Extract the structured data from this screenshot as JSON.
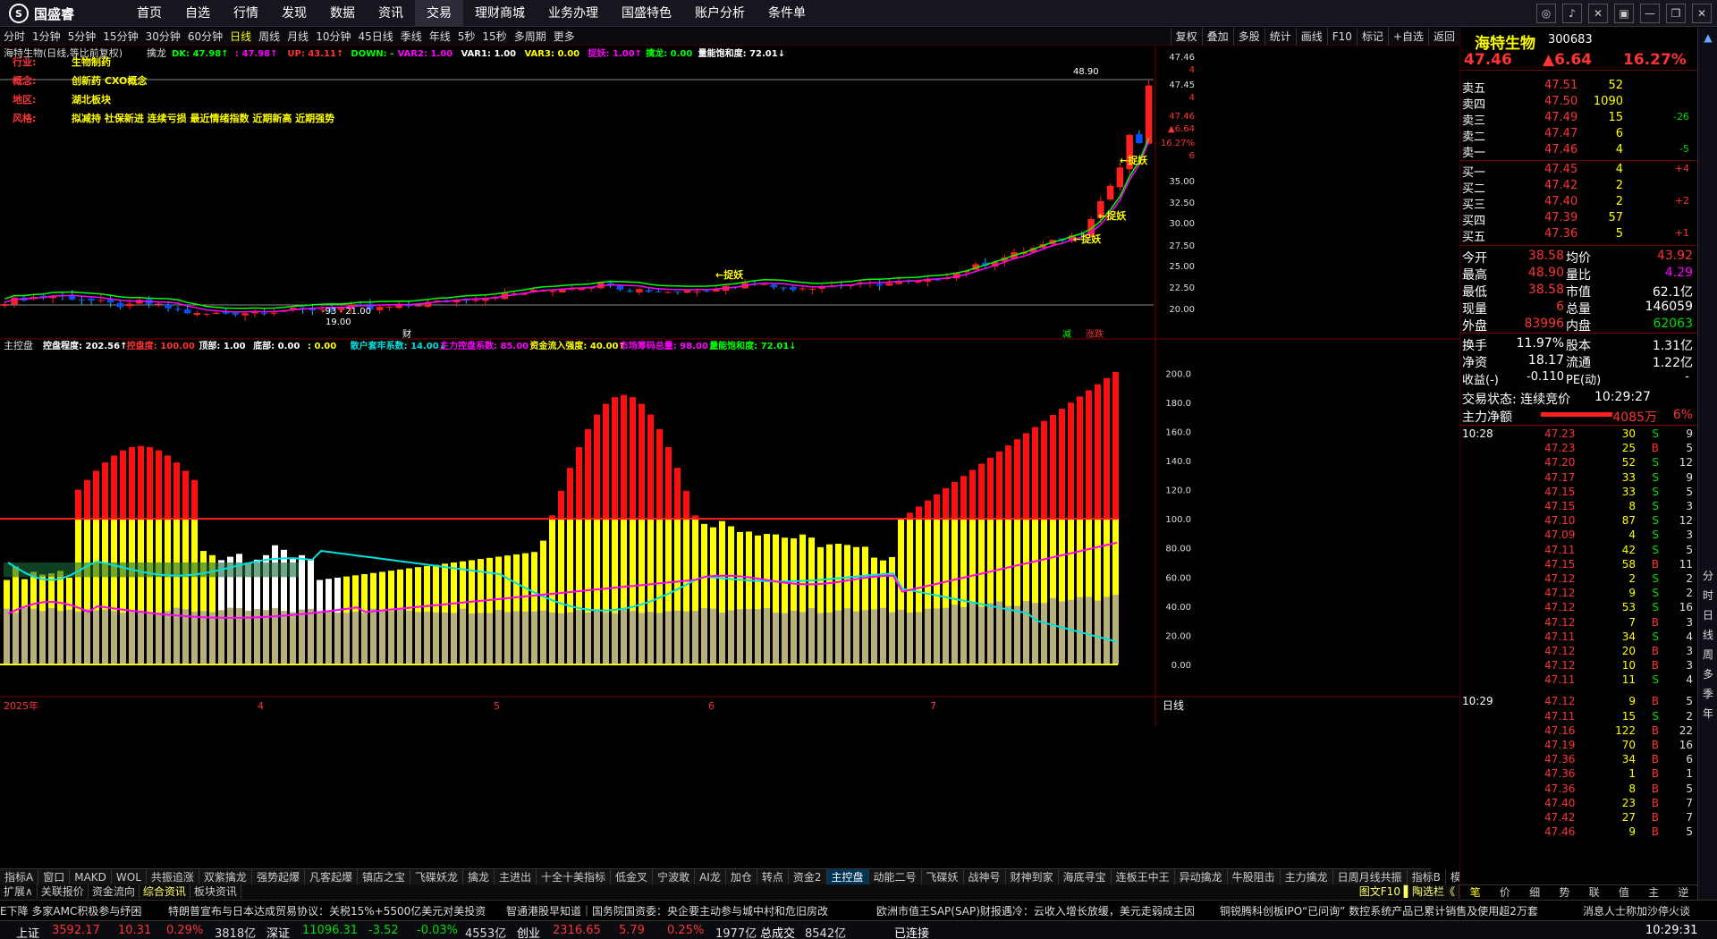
{
  "app": {
    "logo_text": "国盛睿"
  },
  "menu": [
    "首页",
    "自选",
    "行情",
    "发现",
    "数据",
    "资讯",
    "交易",
    "理财商城",
    "业务办理",
    "国盛特色",
    "账户分析",
    "条件单"
  ],
  "menu_active": 6,
  "window_buttons": [
    "chat-icon",
    "bell-icon",
    "tools-icon",
    "shirt-icon",
    "minimize-icon",
    "restore-icon",
    "close-icon"
  ],
  "periods": [
    "分时",
    "1分钟",
    "5分钟",
    "15分钟",
    "30分钟",
    "60分钟",
    "日线",
    "周线",
    "月线",
    "10分钟",
    "45日线",
    "季线",
    "年线",
    "5秒",
    "15秒",
    "多周期",
    "更多"
  ],
  "period_active": 6,
  "toolbar": [
    "复权",
    "叠加",
    "多股",
    "统计",
    "画线",
    "F10",
    "标记",
    "+自选",
    "返回"
  ],
  "stock": {
    "name": "海特生物",
    "code": "300683",
    "price": "47.46",
    "change": "▲6.64",
    "pct": "16.27%"
  },
  "kline_header": {
    "title": "海特生物(日线,等比前复权)",
    "indicator": "擒龙",
    "items": [
      {
        "text": "DK: 47.98↑",
        "color": "#00ff00"
      },
      {
        "text": ": 47.98↑",
        "color": "#ff00ff"
      },
      {
        "text": "UP: 43.11↑",
        "color": "#ff3333"
      },
      {
        "text": "DOWN: -",
        "color": "#00ff00"
      },
      {
        "text": "VAR2: 1.00",
        "color": "#ff00ff"
      },
      {
        "text": "VAR1: 1.00",
        "color": "#ffffff"
      },
      {
        "text": "VAR3: 0.00",
        "color": "#ffff00"
      },
      {
        "text": "捉妖: 1.00↑",
        "color": "#ff00ff"
      },
      {
        "text": "擒龙: 0.00",
        "color": "#00ff00"
      },
      {
        "text": "量能饱和度: 72.01↓",
        "color": "#ffffff"
      }
    ]
  },
  "info_rows": [
    {
      "label": "行业:",
      "value": "生物制药"
    },
    {
      "label": "概念:",
      "value": "创新药 CXO概念"
    },
    {
      "label": "地区:",
      "value": "湖北板块"
    },
    {
      "label": "风格:",
      "value": "拟减持 社保新进 连续亏损 最近情绪指数 近期新高 近期强势"
    }
  ],
  "price_axis": [
    "47.46",
    "4",
    "47.45",
    "4",
    "47.46",
    "▲6.64",
    "16.27%",
    "6",
    "35.00",
    "32.50",
    "30.00",
    "27.50",
    "25.00",
    "22.50",
    "20.00"
  ],
  "kline_annotations": {
    "high": "48.90",
    "low": "19.00",
    "low_range": "-93 - 21.00",
    "tag": "捉妖",
    "cai": "财",
    "jian": "减",
    "zhang": "涨跌"
  },
  "lower_header": {
    "indicator": "主控盘",
    "items": [
      {
        "text": "控盘程度: 202.56↑",
        "color": "#ffffff"
      },
      {
        "text": "控盘度: 100.00",
        "color": "#ff3333"
      },
      {
        "text": "顶部: 1.00",
        "color": "#ffffff"
      },
      {
        "text": "底部: 0.00",
        "color": "#ffffff"
      },
      {
        "text": ": 0.00",
        "color": "#ffff00"
      },
      {
        "text": "散户套牢系数: 14.00↓",
        "color": "#00e0e0"
      },
      {
        "text": "主力控盘系数: 85.00↑",
        "color": "#ff00ff"
      },
      {
        "text": "资金流入强度: 40.00↑",
        "color": "#ffff00"
      },
      {
        "text": "市场筹码总量: 98.00↓",
        "color": "#ff00ff"
      },
      {
        "text": "量能饱和度: 72.01↓",
        "color": "#00ff00"
      }
    ]
  },
  "lower_axis": [
    "200.0",
    "180.0",
    "160.0",
    "140.0",
    "120.0",
    "100.0",
    "80.00",
    "60.00",
    "40.00",
    "20.00",
    "0.00"
  ],
  "date_labels": [
    "2025年",
    "4",
    "5",
    "6",
    "7"
  ],
  "period_label": "日线",
  "bottom_tabs": [
    "指标A",
    "窗口",
    "MAKD",
    "WOL",
    "共振追涨",
    "双紫擒龙",
    "强势起爆",
    "凡客起爆",
    "镇店之宝",
    "飞碟妖龙",
    "擒龙",
    "主进出",
    "十全十美指标",
    "低金叉",
    "宁波敢",
    "AI龙",
    "加仓",
    "转点",
    "资金2",
    "主控盘",
    "动能二号",
    "飞碟妖",
    "战神号",
    "财神到家",
    "海底寻宝",
    "连板王中王",
    "异动擒龙",
    "牛股阻击",
    "主力擒龙",
    "日周月线共振",
    "指标B",
    "模板"
  ],
  "bottom_tab_active": 19,
  "sub_tabs": [
    "扩展∧",
    "关联报价",
    "资金流向",
    "综合资讯",
    "板块资讯"
  ],
  "sub_tab_active": 3,
  "sub_tabs_right": "图文F10 ▌陶选栏《",
  "news": [
    "E下降  多家AMC积极参与纾困",
    "特朗普宣布与日本达成贸易协议：关税15%+5500亿美元对美投资",
    "智通港股早知道｜国务院国资委：央企要主动参与城中村和危旧房改",
    "欧洲市值王SAP(SAP)财报遇冷：云收入增长放缓，美元走弱成主因",
    "铜锐腾科创板IPO“已问询” 数控系统产品已累计销售及使用超2万套",
    "消息人士称加沙停火谈"
  ],
  "status": [
    {
      "label": "上证",
      "val": "3592.17",
      "chg": "10.31",
      "pct": "0.29%",
      "amt": "3818亿"
    },
    {
      "label": "深证",
      "val": "11096.31",
      "chg": "-3.52",
      "pct": "-0.03%",
      "amt": "4553亿"
    },
    {
      "label": "创业",
      "val": "2316.65",
      "chg": "5.79",
      "pct": "0.25%",
      "amt": "1977亿"
    }
  ],
  "total_amount_label": "总成交",
  "total_amount": "8542亿",
  "connected": "已连接",
  "clock": "10:29:31",
  "order_book": {
    "asks": [
      {
        "label": "卖五",
        "price": "47.51",
        "vol": "52",
        "chg": ""
      },
      {
        "label": "卖四",
        "price": "47.50",
        "vol": "1090",
        "chg": ""
      },
      {
        "label": "卖三",
        "price": "47.49",
        "vol": "15",
        "chg": "-26"
      },
      {
        "label": "卖二",
        "price": "47.47",
        "vol": "6",
        "chg": ""
      },
      {
        "label": "卖一",
        "price": "47.46",
        "vol": "4",
        "chg": "-5"
      }
    ],
    "bids": [
      {
        "label": "买一",
        "price": "47.45",
        "vol": "4",
        "chg": "+4"
      },
      {
        "label": "买二",
        "price": "47.42",
        "vol": "2",
        "chg": ""
      },
      {
        "label": "买三",
        "price": "47.40",
        "vol": "2",
        "chg": "+2"
      },
      {
        "label": "买四",
        "price": "47.39",
        "vol": "57",
        "chg": ""
      },
      {
        "label": "买五",
        "price": "47.36",
        "vol": "5",
        "chg": "+1"
      }
    ]
  },
  "quote": [
    {
      "l1": "今开",
      "v1": "38.58",
      "c1": "#ff3333",
      "l2": "均价",
      "v2": "43.92",
      "c2": "#ff3333"
    },
    {
      "l1": "最高",
      "v1": "48.90",
      "c1": "#ff3333",
      "l2": "量比",
      "v2": "4.29",
      "c2": "#ff00ff"
    },
    {
      "l1": "最低",
      "v1": "38.58",
      "c1": "#ff3333",
      "l2": "市值",
      "v2": "62.1亿",
      "c2": "#ffffff"
    },
    {
      "l1": "现量",
      "v1": "6",
      "c1": "#ff3333",
      "l2": "总量",
      "v2": "146059",
      "c2": "#ffffff"
    },
    {
      "l1": "外盘",
      "v1": "83996",
      "c1": "#ff3333",
      "l2": "内盘",
      "v2": "62063",
      "c2": "#00dd00"
    },
    {
      "l1": "换手",
      "v1": "11.97%",
      "c1": "#ffffff",
      "l2": "股本",
      "v2": "1.31亿",
      "c2": "#ffffff"
    },
    {
      "l1": "净资",
      "v1": "18.17",
      "c1": "#ffffff",
      "l2": "流通",
      "v2": "1.22亿",
      "c2": "#ffffff"
    }
  ],
  "earnings": {
    "label": "收益(-)",
    "value": "-0.110",
    "pe_label": "PE(动)",
    "pe": "-"
  },
  "trade_state": {
    "label": "交易状态: 连续竞价",
    "time": "10:29:27"
  },
  "main_flow": {
    "label": "主力净额",
    "value": "4085万",
    "pct": "6%"
  },
  "ticks": [
    {
      "t": "10:28",
      "p": "47.23",
      "v": "30",
      "d": "S",
      "n": "9"
    },
    {
      "t": "",
      "p": "47.23",
      "v": "25",
      "d": "B",
      "n": "5"
    },
    {
      "t": "",
      "p": "47.20",
      "v": "52",
      "d": "S",
      "n": "12"
    },
    {
      "t": "",
      "p": "47.17",
      "v": "33",
      "d": "S",
      "n": "9"
    },
    {
      "t": "",
      "p": "47.15",
      "v": "33",
      "d": "S",
      "n": "5"
    },
    {
      "t": "",
      "p": "47.15",
      "v": "8",
      "d": "S",
      "n": "3"
    },
    {
      "t": "",
      "p": "47.10",
      "v": "87",
      "d": "S",
      "n": "12"
    },
    {
      "t": "",
      "p": "47.09",
      "v": "4",
      "d": "S",
      "n": "3"
    },
    {
      "t": "",
      "p": "47.11",
      "v": "42",
      "d": "S",
      "n": "5"
    },
    {
      "t": "",
      "p": "47.15",
      "v": "58",
      "d": "B",
      "n": "11"
    },
    {
      "t": "",
      "p": "47.12",
      "v": "2",
      "d": "S",
      "n": "2"
    },
    {
      "t": "",
      "p": "47.12",
      "v": "9",
      "d": "S",
      "n": "2"
    },
    {
      "t": "",
      "p": "47.12",
      "v": "53",
      "d": "S",
      "n": "16"
    },
    {
      "t": "",
      "p": "47.12",
      "v": "7",
      "d": "B",
      "n": "3"
    },
    {
      "t": "",
      "p": "47.11",
      "v": "34",
      "d": "S",
      "n": "4"
    },
    {
      "t": "",
      "p": "47.12",
      "v": "20",
      "d": "B",
      "n": "3"
    },
    {
      "t": "",
      "p": "47.12",
      "v": "10",
      "d": "B",
      "n": "3"
    },
    {
      "t": "",
      "p": "47.11",
      "v": "11",
      "d": "S",
      "n": "4"
    },
    {
      "t": "10:29",
      "p": "47.12",
      "v": "9",
      "d": "B",
      "n": "5"
    },
    {
      "t": "",
      "p": "47.11",
      "v": "15",
      "d": "S",
      "n": "2"
    },
    {
      "t": "",
      "p": "47.16",
      "v": "122",
      "d": "B",
      "n": "22"
    },
    {
      "t": "",
      "p": "47.19",
      "v": "70",
      "d": "B",
      "n": "16"
    },
    {
      "t": "",
      "p": "47.36",
      "v": "34",
      "d": "B",
      "n": "6"
    },
    {
      "t": "",
      "p": "47.36",
      "v": "1",
      "d": "B",
      "n": "1"
    },
    {
      "t": "",
      "p": "47.36",
      "v": "8",
      "d": "B",
      "n": "5"
    },
    {
      "t": "",
      "p": "47.40",
      "v": "23",
      "d": "B",
      "n": "7"
    },
    {
      "t": "",
      "p": "47.42",
      "v": "27",
      "d": "B",
      "n": "7"
    },
    {
      "t": "",
      "p": "47.46",
      "v": "9",
      "d": "B",
      "n": "5"
    }
  ],
  "rp_tabs": [
    "笔",
    "价",
    "细",
    "势",
    "联",
    "值",
    "主",
    "逆"
  ],
  "side_icons": [
    "分",
    "时",
    "日",
    "线",
    "周",
    "多",
    "季",
    "年"
  ]
}
